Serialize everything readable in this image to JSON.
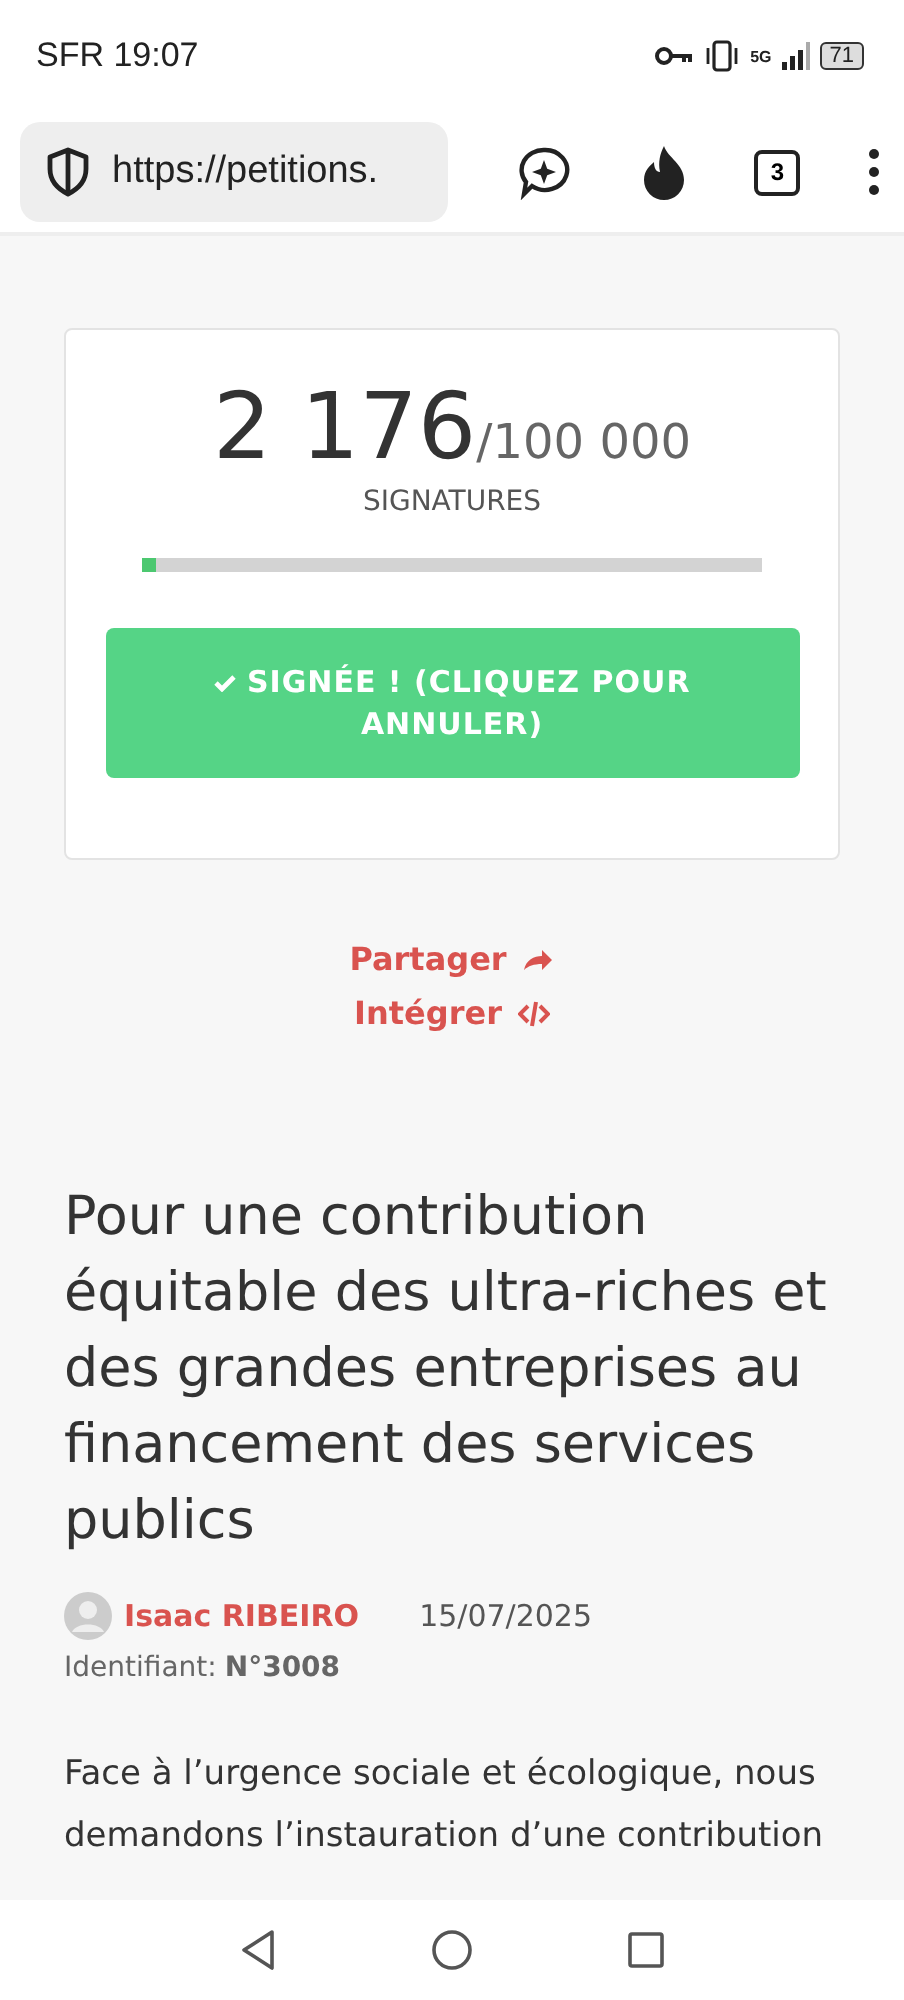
{
  "status_bar": {
    "carrier_time": "SFR 19:07",
    "network": "5G",
    "battery": "71"
  },
  "browser": {
    "url": "https://petitions.",
    "tab_count": "3"
  },
  "counter": {
    "count": "2 176",
    "goal": "/100 000",
    "label": "SIGNATURES",
    "level": 0.022
  },
  "sign_button": {
    "label": "SIGNÉE ! (CLIQUEZ POUR ANNULER)",
    "signed": true
  },
  "links": [
    {
      "kind": "share",
      "label": "Partager"
    },
    {
      "kind": "embed",
      "label": "Intégrer"
    }
  ],
  "petition": {
    "title": "Pour une contribution équitable des ultra-riches et des grandes entreprises au financement des services publics",
    "author": "Isaac RIBEIRO",
    "date": "15/07/2025",
    "id_label": "Identifiant:",
    "id_value": "N°3008",
    "body": "Face à l’urgence sociale et écologique, nous demandons l’instauration d’une contribution"
  }
}
